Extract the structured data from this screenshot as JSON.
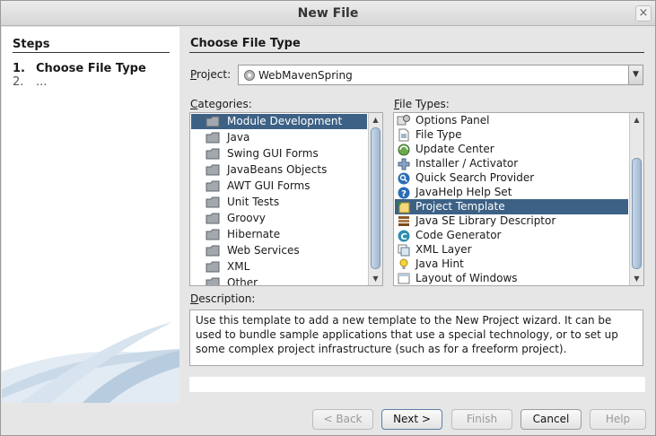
{
  "window": {
    "title": "New File",
    "close_glyph": "×"
  },
  "steps": {
    "title": "Steps",
    "items": [
      {
        "num": "1.",
        "label": "Choose File Type"
      },
      {
        "num": "2.",
        "label": "..."
      }
    ]
  },
  "main": {
    "title": "Choose File Type",
    "project_label_mnemonic": "P",
    "project_label_rest": "roject:",
    "project_value": "WebMavenSpring",
    "categories_label_mnemonic": "C",
    "categories_label_rest": "ategories:",
    "file_types_label_mnemonic": "F",
    "file_types_label_rest": "ile Types:",
    "description_label_mnemonic": "D",
    "description_label_rest": "escription:",
    "description": "Use this template to add a new template to the New Project wizard. It can be used to bundle sample applications that use a special technology, or to set up some complex project infrastructure (such as for a freeform project)."
  },
  "categories": [
    {
      "label": "Module Development",
      "selected": true
    },
    {
      "label": "Java"
    },
    {
      "label": "Swing GUI Forms"
    },
    {
      "label": "JavaBeans Objects"
    },
    {
      "label": "AWT GUI Forms"
    },
    {
      "label": "Unit Tests"
    },
    {
      "label": "Groovy"
    },
    {
      "label": "Hibernate"
    },
    {
      "label": "Web Services"
    },
    {
      "label": "XML"
    },
    {
      "label": "Other"
    }
  ],
  "file_types": [
    {
      "label": "Options Panel",
      "icon": "options-panel-icon"
    },
    {
      "label": "File Type",
      "icon": "file-type-icon"
    },
    {
      "label": "Update Center",
      "icon": "update-center-icon"
    },
    {
      "label": "Installer / Activator",
      "icon": "installer-icon"
    },
    {
      "label": "Quick Search Provider",
      "icon": "quick-search-icon"
    },
    {
      "label": "JavaHelp Help Set",
      "icon": "help-icon"
    },
    {
      "label": "Project Template",
      "icon": "project-template-icon",
      "selected": true
    },
    {
      "label": "Java SE Library Descriptor",
      "icon": "library-icon"
    },
    {
      "label": "Code Generator",
      "icon": "code-generator-icon"
    },
    {
      "label": "XML Layer",
      "icon": "xml-layer-icon"
    },
    {
      "label": "Java Hint",
      "icon": "hint-icon"
    },
    {
      "label": "Layout of Windows",
      "icon": "layout-icon"
    }
  ],
  "buttons": {
    "back": "< Back",
    "back_mnemonic": "B",
    "next": "Next >",
    "finish": "Finish",
    "cancel": "Cancel",
    "help": "Help"
  },
  "colors": {
    "selection": "#3d6185",
    "folder": "#8a8f96",
    "accent_blue": "#2a6db5"
  }
}
